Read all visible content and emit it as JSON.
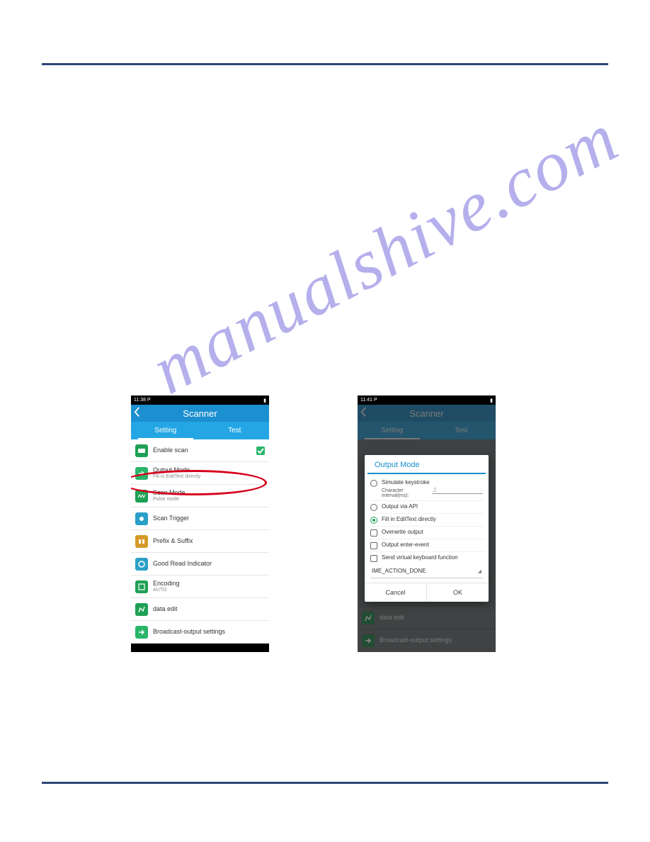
{
  "watermark": "manualshive.com",
  "phone1": {
    "time": "11:38",
    "status_letter": "P",
    "header_title": "Scanner",
    "tabs": {
      "setting": "Setting",
      "test": "Test"
    },
    "rows": {
      "enable": "Enable scan",
      "output_mode": "Output Mode",
      "output_mode_sub": "Fill in EditText directly",
      "scan_mode": "Scan Mode",
      "scan_mode_sub": "Pulse mode",
      "scan_trigger": "Scan Trigger",
      "prefix_suffix": "Prefix & Suffix",
      "good_read": "Good Read Indicator",
      "encoding": "Encoding",
      "encoding_sub": "AUTO",
      "data_edit": "data edit",
      "broadcast": "Broadcast-output settings"
    }
  },
  "phone2": {
    "time": "11:41",
    "status_letter": "P",
    "header_title": "Scanner",
    "tabs": {
      "setting": "Setting",
      "test": "Test"
    },
    "bg_rows": {
      "data_edit": "data edit",
      "broadcast": "Broadcast-output settings"
    },
    "dialog": {
      "title": "Output Mode",
      "simulate_keystroke": "Simulate keystroke",
      "interval_label": "Character interval(ms):",
      "interval_value": "2",
      "output_api": "Output via API",
      "fill_edittext": "Fill in EditText directly",
      "overwrite_output": "Overwrite output",
      "output_enter_event": "Output enter-event",
      "send_virtual_kb": "Send virtual keyboard function",
      "ime_action": "IME_ACTION_DONE",
      "cancel": "Cancel",
      "ok": "OK"
    }
  }
}
